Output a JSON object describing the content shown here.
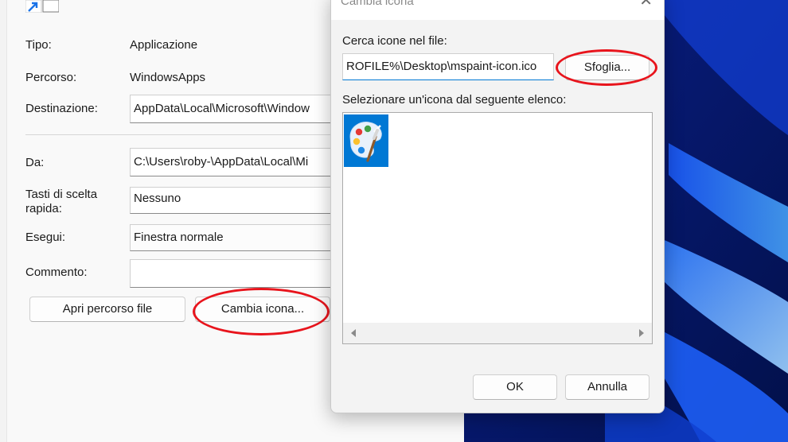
{
  "properties": {
    "rows": {
      "tipo_label": "Tipo:",
      "tipo_value": "Applicazione",
      "percorso_label": "Percorso:",
      "percorso_value": "WindowsApps",
      "destinazione_label": "Destinazione:",
      "destinazione_value": "AppData\\Local\\Microsoft\\Window",
      "da_label": "Da:",
      "da_value": "C:\\Users\\roby-\\AppData\\Local\\Mi",
      "tasti_label": "Tasti di scelta rapida:",
      "tasti_value": "Nessuno",
      "esegui_label": "Esegui:",
      "esegui_value": "Finestra normale",
      "commento_label": "Commento:",
      "commento_value": ""
    },
    "buttons": {
      "apri_percorso": "Apri percorso file",
      "cambia_icona": "Cambia icona..."
    }
  },
  "dialog": {
    "title": "Cambia icona",
    "close_glyph": "✕",
    "search_label": "Cerca icone nel file:",
    "file_path": "ROFILE%\\Desktop\\mspaint-icon.ico",
    "browse_button": "Sfoglia...",
    "list_label": "Selezionare un'icona dal seguente elenco:",
    "icons": [
      "paint-palette-icon"
    ],
    "ok_button": "OK",
    "cancel_button": "Annulla"
  },
  "colors": {
    "highlight_red": "#e8141c",
    "accent_blue": "#0078d4"
  }
}
